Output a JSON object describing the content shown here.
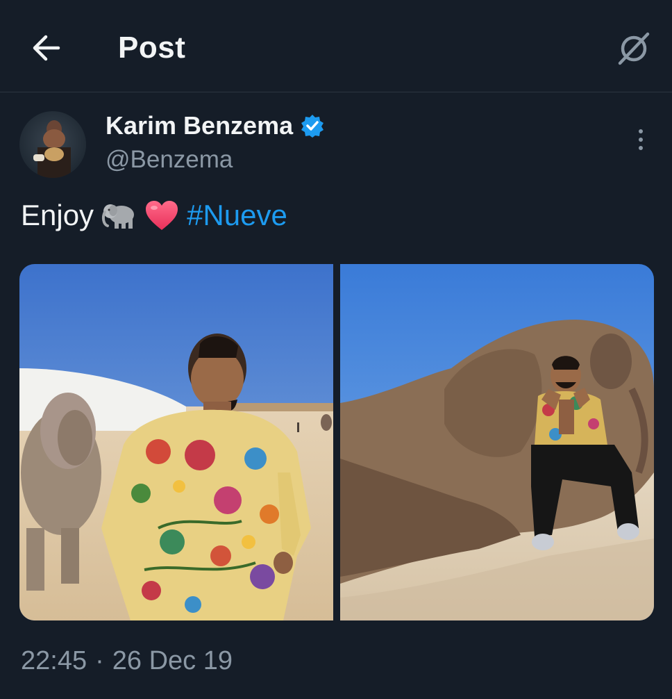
{
  "header": {
    "title": "Post",
    "back_icon": "arrow-left-icon",
    "grok_icon": "grok-icon"
  },
  "author": {
    "name": "Karim Benzema",
    "handle": "@Benzema",
    "verified": true,
    "verified_color": "#1d9bf0"
  },
  "tweet": {
    "text": "Enjoy",
    "emojis": [
      "elephant-emoji",
      "heart-emoji"
    ],
    "hashtag": "#Nueve"
  },
  "media": {
    "photos": [
      {
        "description": "man-in-floral-shirt-with-elephant"
      },
      {
        "description": "man-sitting-on-elephant"
      }
    ]
  },
  "meta": {
    "time": "22:45",
    "separator": "·",
    "date": "26 Dec 19"
  },
  "colors": {
    "background": "#151d28",
    "accent": "#1d9bf0",
    "muted": "#8b98a5"
  }
}
